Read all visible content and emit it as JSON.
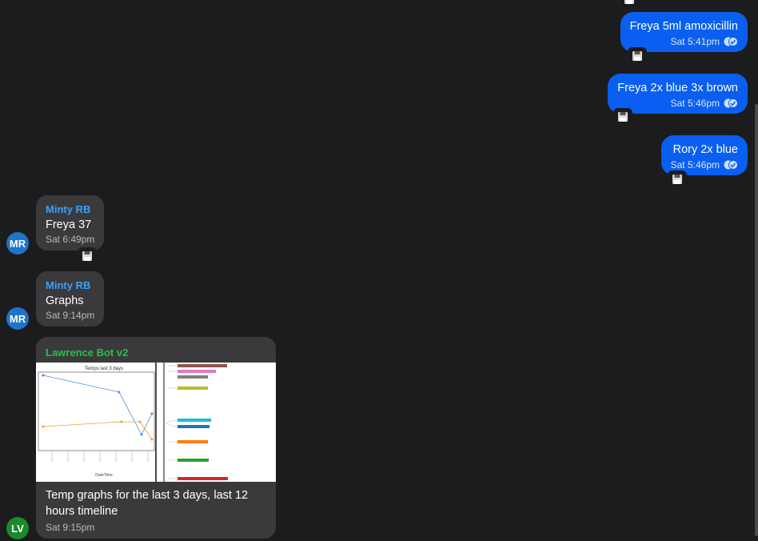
{
  "colors": {
    "background": "#1c1c1e",
    "outgoing_bubble": "#0a5ff0",
    "incoming_bubble": "#3a3a3c",
    "minty_name": "#3aa0ff",
    "bot_name": "#2bbd4c",
    "avatar_mr": "#1e74c6",
    "avatar_lv": "#1b8a2c"
  },
  "outgoing": [
    {
      "text": "Freya 5ml amoxicillin",
      "time": "Sat 5:41pm",
      "status_icon": "read-ticks-icon",
      "action_icon": "save-icon"
    },
    {
      "text": "Freya 2x blue 3x brown",
      "time": "Sat 5:46pm",
      "status_icon": "read-ticks-icon",
      "action_icon": "save-icon"
    },
    {
      "text": "Rory 2x blue",
      "time": "Sat 5:46pm",
      "status_icon": "read-ticks-icon",
      "action_icon": "save-icon"
    }
  ],
  "incoming": [
    {
      "avatar": "MR",
      "sender": "Minty RB",
      "text": "Freya 37",
      "time": "Sat 6:49pm",
      "action_icon": "save-icon"
    },
    {
      "avatar": "MR",
      "sender": "Minty RB",
      "text": "Graphs",
      "time": "Sat 9:14pm"
    }
  ],
  "bot_message": {
    "avatar": "LV",
    "sender": "Lawrence Bot v2",
    "image_title": "Temps last 3 days",
    "image_xlabel": "DateTime",
    "caption": "Temp graphs for the last 3 days, last 12 hours timeline",
    "time": "Sat 9:15pm"
  }
}
